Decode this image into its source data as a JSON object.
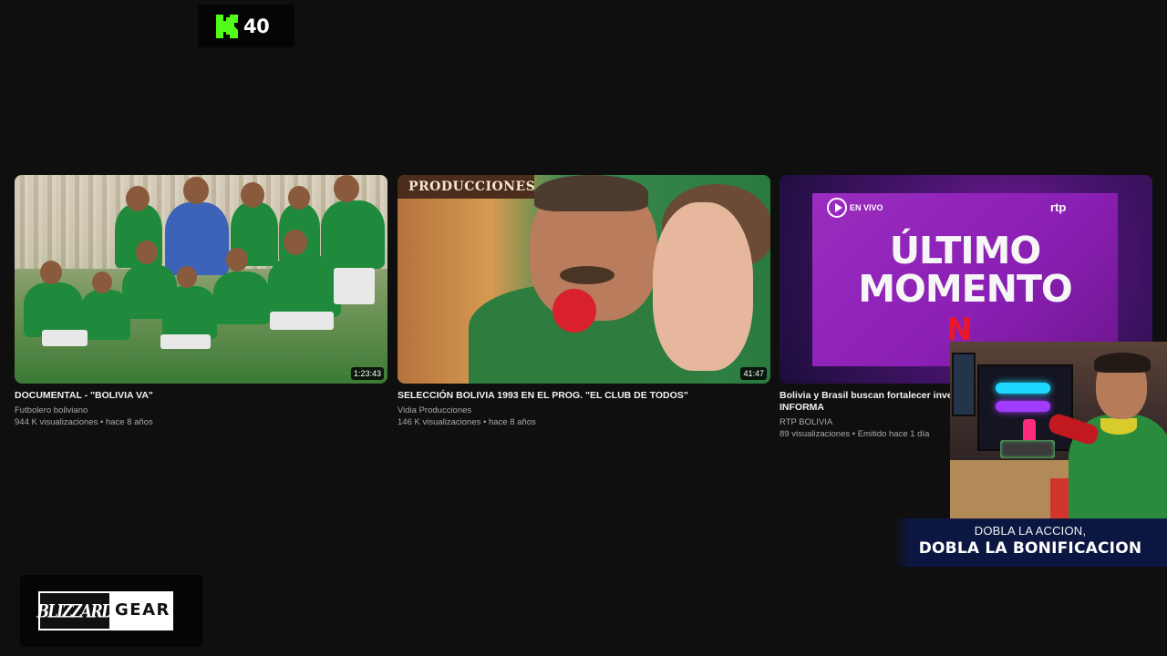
{
  "kick_badge": {
    "count": "40",
    "accent": "#53fc18"
  },
  "videos": [
    {
      "title": "DOCUMENTAL - \"BOLIVIA VA\"",
      "channel": "Futbolero boliviano",
      "meta": "944 K visualizaciones • hace 8 años",
      "duration": "1:23:43"
    },
    {
      "title": "SELECCIÓN BOLIVIA 1993 EN EL PROG. \"EL CLUB DE TODOS\"",
      "channel": "Vidia Producciones",
      "meta": "146 K visualizaciones • hace 8 años",
      "duration": "41:47",
      "thumb_text": "PRODUCCIONES"
    },
    {
      "title_line1": "Bolivia y Brasil buscan fortalecer inver",
      "title_line2": "INFORMA",
      "channel": "RTP BOLIVIA",
      "meta": "89 visualizaciones • Emitido hace 1 día",
      "thumb_live": "EN VIVO",
      "thumb_brand": "rtp",
      "thumb_headline": "ÚLTIMO MOMENTO",
      "thumb_mark": "N"
    }
  ],
  "promo": {
    "line1": "DOBLA LA ACCION,",
    "line2": "DOBLA LA BONIFICACION"
  },
  "ad": {
    "logo": "BLIZZARD",
    "product": "GEAR"
  },
  "colors": {
    "background": "#0f0f0f",
    "kick_green": "#53fc18",
    "secondary_text": "#aaaaaa"
  }
}
